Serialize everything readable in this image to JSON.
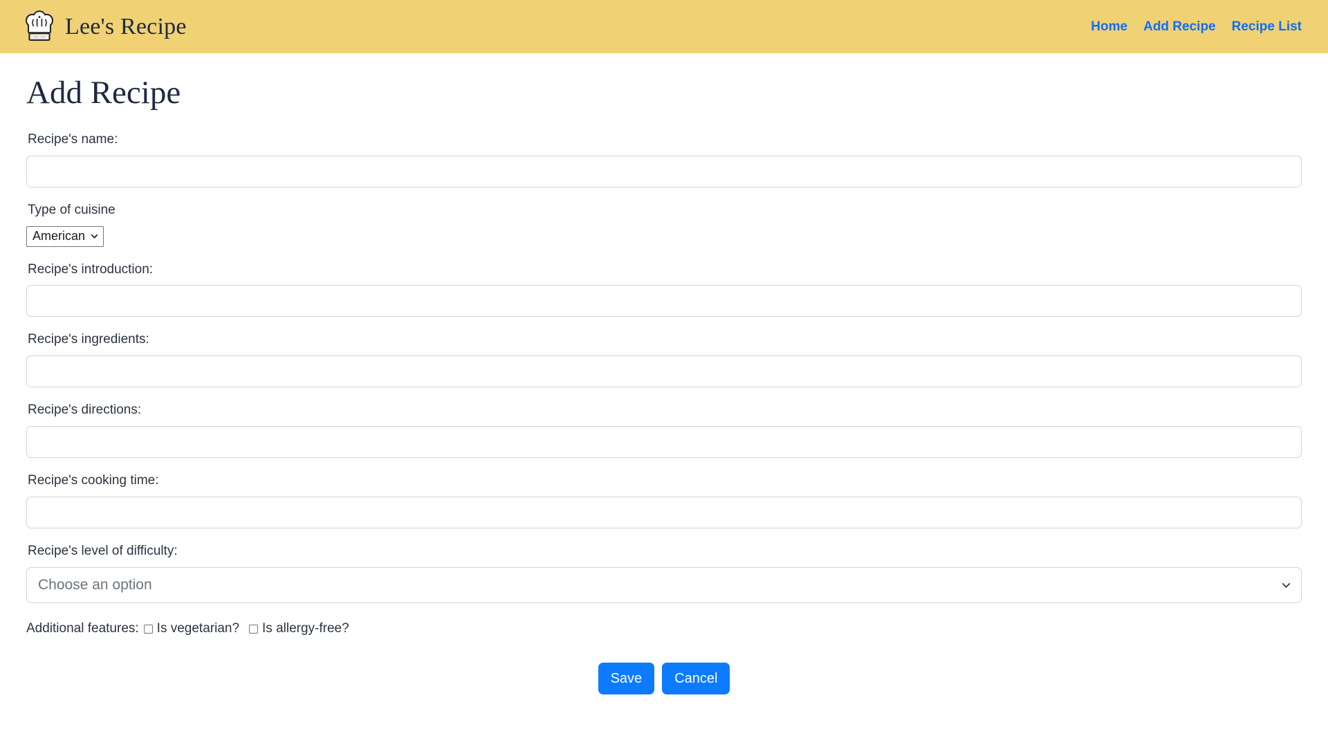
{
  "header": {
    "brand_name": "Lee's Recipe",
    "logo_icon": "chef-hat-icon",
    "background_color": "#f0d174",
    "nav": [
      {
        "label": "Home"
      },
      {
        "label": "Add Recipe"
      },
      {
        "label": "Recipe List"
      }
    ],
    "nav_link_color": "#0d6efd"
  },
  "page": {
    "title": "Add Recipe"
  },
  "form": {
    "name_label": "Recipe's name:",
    "name_value": "",
    "cuisine_label": "Type of cuisine",
    "cuisine_selected": "American",
    "cuisine_icon": "chevron-down-icon",
    "introduction_label": "Recipe's introduction:",
    "introduction_value": "",
    "ingredients_label": "Recipe's ingredients:",
    "ingredients_value": "",
    "directions_label": "Recipe's directions:",
    "directions_value": "",
    "cooking_time_label": "Recipe's cooking time:",
    "cooking_time_value": "",
    "difficulty_label": "Recipe's level of difficulty:",
    "difficulty_selected": "Choose an option",
    "difficulty_icon": "chevron-down-icon",
    "features_label": "Additional features:",
    "vegetarian_label": "Is vegetarian?",
    "vegetarian_checked": false,
    "allergy_free_label": "Is allergy-free?",
    "allergy_free_checked": false
  },
  "actions": {
    "save_label": "Save",
    "cancel_label": "Cancel",
    "button_color": "#0d7bff"
  }
}
